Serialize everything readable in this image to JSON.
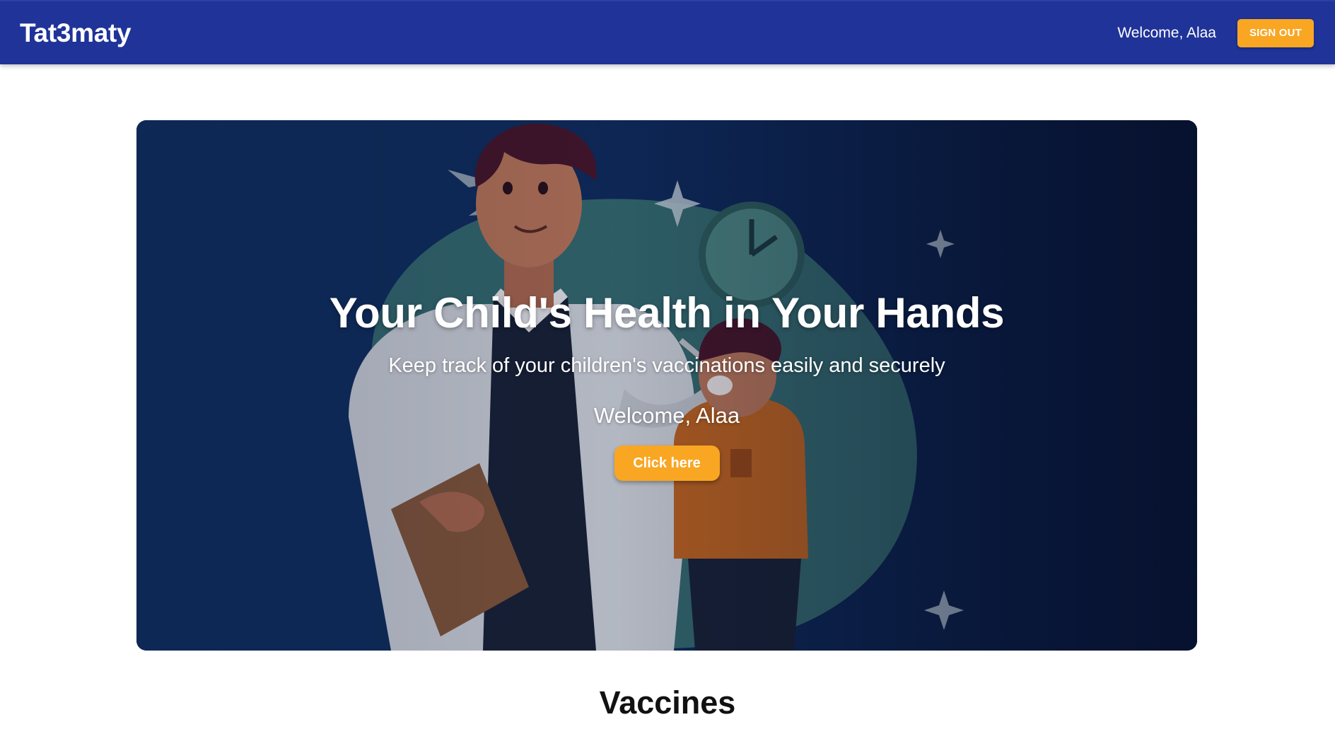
{
  "header": {
    "brand": "Tat3maty",
    "welcome": "Welcome, Alaa",
    "signout_label": "SIGN OUT"
  },
  "hero": {
    "title": "Your Child's Health in Your Hands",
    "subtitle": "Keep track of your children's vaccinations easily and securely",
    "welcome": "Welcome, Alaa",
    "cta_label": "Click here"
  },
  "sections": {
    "vaccines_title": "Vaccines"
  },
  "colors": {
    "appbar": "#1f3399",
    "accent": "#f9a623",
    "hero_bg": "#0f2452"
  }
}
